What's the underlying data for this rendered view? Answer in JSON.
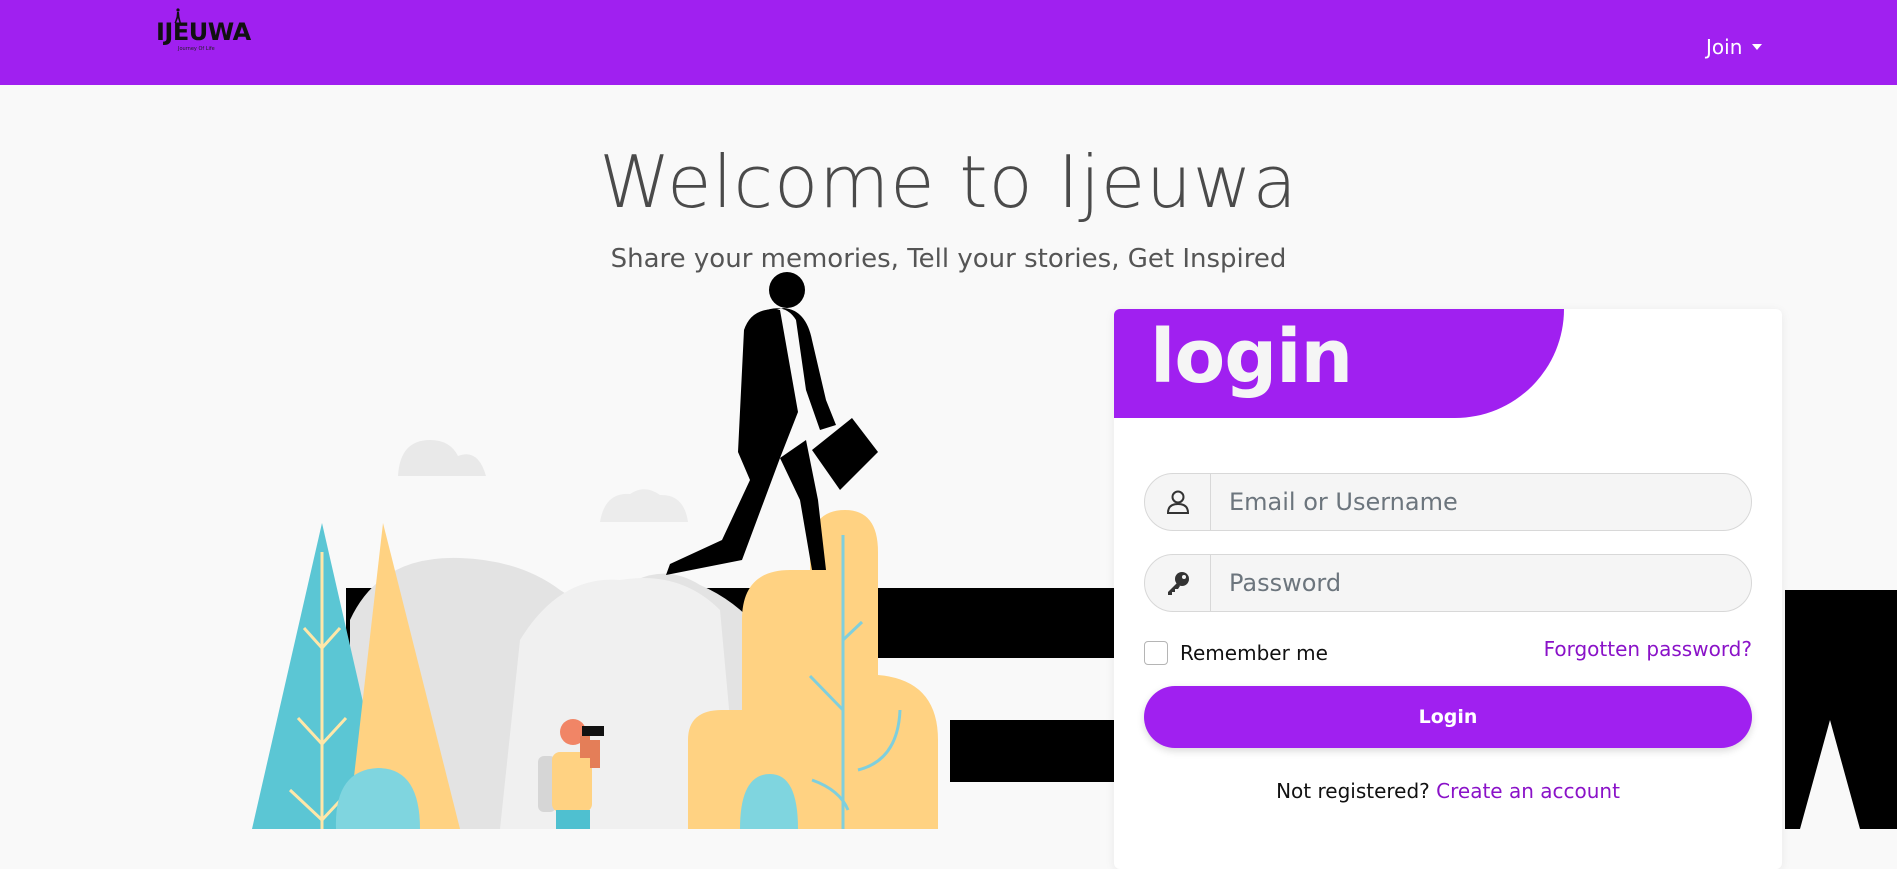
{
  "navbar": {
    "logo_text": "IJEUWA",
    "logo_tagline": "Journey Of Life",
    "join_label": "Join",
    "background_color": "#a020f0"
  },
  "hero": {
    "title": "Welcome to Ijeuwa",
    "subtitle": "Share your memories, Tell your stories, Get Inspired"
  },
  "login_card": {
    "title": "login",
    "email_placeholder": "Email or Username",
    "password_placeholder": "Password",
    "email_icon": "user-icon",
    "password_icon": "key-icon",
    "remember_label": "Remember me",
    "forgot_label": "Forgotten password?",
    "login_button_label": "Login",
    "not_registered_text": "Not registered?",
    "create_account_label": "Create an account",
    "accent_color": "#a020f0",
    "link_color": "#8a12c8"
  }
}
